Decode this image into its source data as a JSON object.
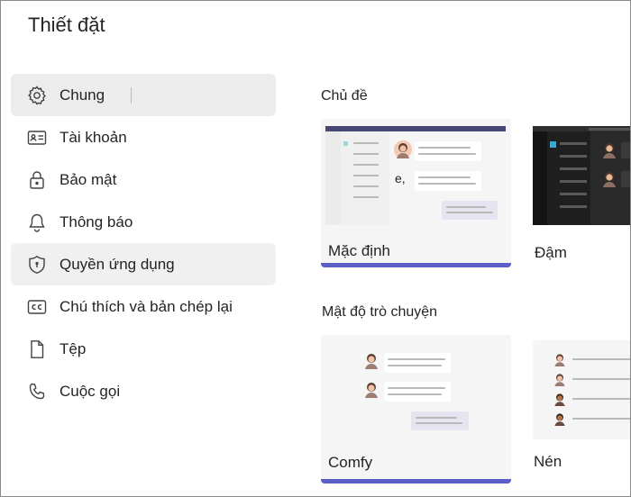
{
  "window": {
    "title": "Thiết đặt"
  },
  "nav": {
    "items": [
      {
        "label": "Chung",
        "icon": "gear-icon"
      },
      {
        "label": "Tài khoản",
        "icon": "id-card-icon"
      },
      {
        "label": "Bảo mật",
        "icon": "lock-icon"
      },
      {
        "label": "Thông báo",
        "icon": "bell-icon"
      },
      {
        "label": "Quyền ứng dụng",
        "icon": "shield-icon"
      },
      {
        "label": "Chú thích và bản chép lại",
        "icon": "cc-icon"
      },
      {
        "label": "Tệp",
        "icon": "file-icon"
      },
      {
        "label": "Cuộc gọi",
        "icon": "phone-icon"
      }
    ]
  },
  "theme": {
    "heading": "Chủ đề",
    "options": [
      {
        "label": "Mặc định",
        "preview_text": "e,"
      },
      {
        "label": "Đậm"
      }
    ]
  },
  "density": {
    "heading": "Mật độ trò chuyện",
    "options": [
      {
        "label": "Comfy"
      },
      {
        "label": "Nén"
      }
    ]
  },
  "colors": {
    "accent": "#5b5fc7",
    "selected_bg": "#ececec",
    "dark_bg": "#1f1f1f"
  }
}
